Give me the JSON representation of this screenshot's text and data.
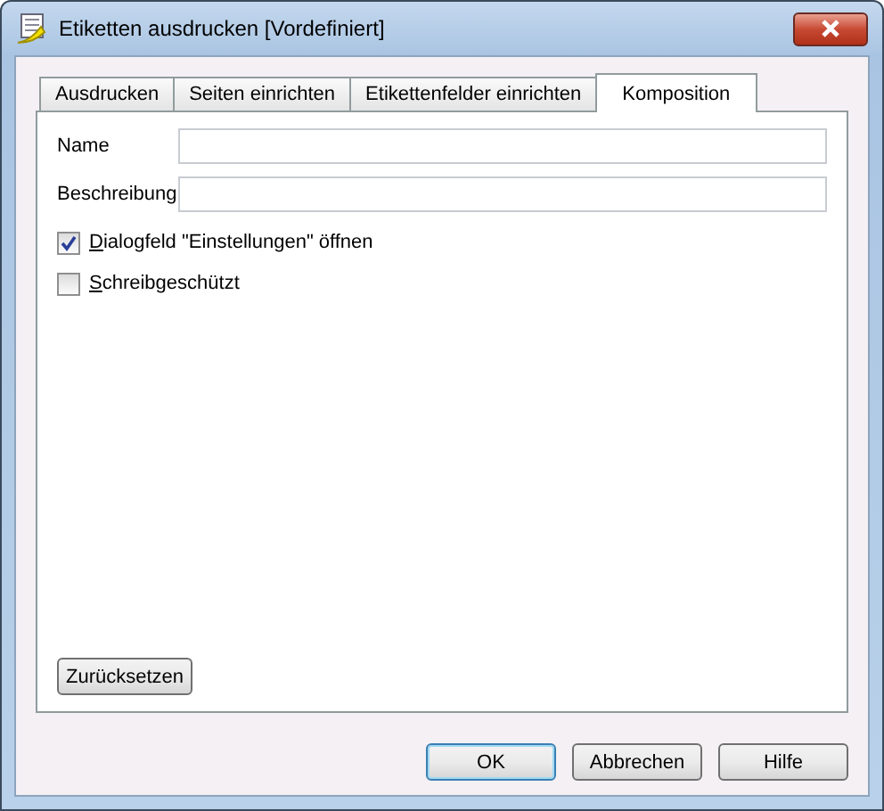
{
  "window": {
    "title": "Etiketten ausdrucken [Vordefiniert]"
  },
  "tabs": [
    {
      "label": "Ausdrucken",
      "selected": false
    },
    {
      "label": "Seiten einrichten",
      "selected": false
    },
    {
      "label": "Etikettenfelder einrichten",
      "selected": false
    },
    {
      "label": "Komposition",
      "selected": true
    }
  ],
  "fields": [
    {
      "label": "Name"
    },
    {
      "label": "Beschreibung"
    }
  ],
  "checkboxes": [
    {
      "label": "Dialogfeld \"Einstellungen\" öffnen",
      "checked": true
    },
    {
      "label": "Schreibgeschützt",
      "checked": false
    }
  ],
  "reset_button": "Zurücksetzen",
  "buttons": [
    {
      "label": "OK",
      "default": true
    },
    {
      "label": "Abbrechen",
      "default": false
    },
    {
      "label": "Hilfe",
      "default": false
    }
  ]
}
